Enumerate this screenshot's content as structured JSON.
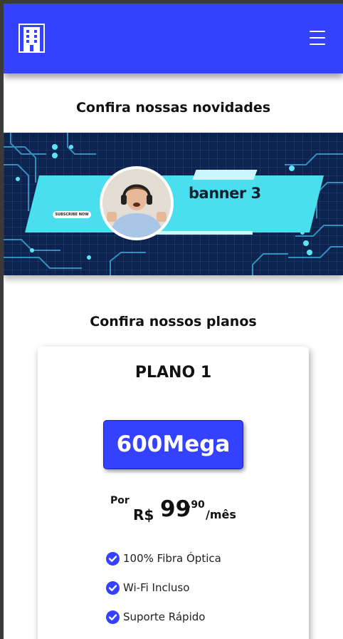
{
  "header": {
    "menu_icon": "hamburger-icon",
    "logo_icon": "building-icon"
  },
  "news": {
    "title": "Confira nossas novidades"
  },
  "banner": {
    "title": "banner 3",
    "subscribe_label": "SUBSCRIBE NOW"
  },
  "plans": {
    "title": "Confira nossos planos",
    "items": [
      {
        "name": "PLANO 1",
        "speed": "600Mega",
        "price_prefix": "Por",
        "currency": "R$",
        "price_int": "99",
        "price_cents": ",90",
        "period": "/mês",
        "features": [
          "100% Fibra Óptica",
          "Wi-Fi Incluso",
          "Suporte Rápido"
        ]
      }
    ]
  },
  "colors": {
    "brand": "#3442ff",
    "banner_bg": "#0c2350",
    "banner_accent": "#4adfef"
  }
}
